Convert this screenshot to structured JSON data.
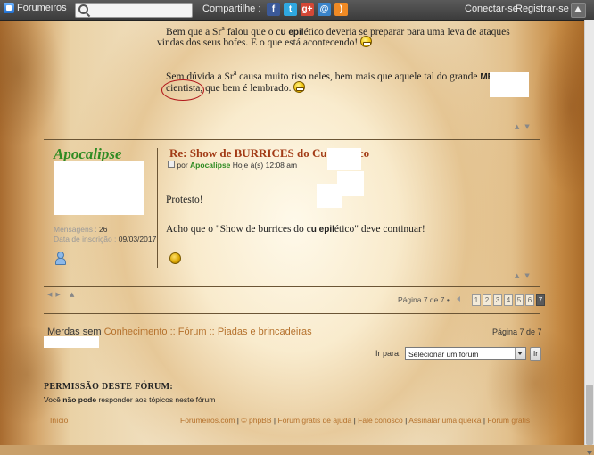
{
  "topbar": {
    "brand": "Forumeiros",
    "share_label": "Compartilhe :",
    "share_icons": [
      {
        "name": "facebook-icon",
        "glyph": "f",
        "color": "#3b5998"
      },
      {
        "name": "twitter-icon",
        "glyph": "t",
        "color": "#2fa8e0"
      },
      {
        "name": "google-plus-icon",
        "glyph": "g+",
        "color": "#d34836"
      },
      {
        "name": "email-icon",
        "glyph": "@",
        "color": "#3a84c9"
      },
      {
        "name": "rss-icon",
        "glyph": ")",
        "color": "#f08a24"
      }
    ],
    "login": "Conectar-se",
    "register": "Registrar-se"
  },
  "post1": {
    "line1a": "Bem que a Sr",
    "sup": "a",
    "line1b": " falou que o c",
    "u": "u",
    "line1c": " epil",
    "line1d": "ético deveria se preparar para uma leva de ataques",
    "line2": "vindas dos seus bofes. E o que está acontecendo!",
    "line3a": "Sem dúvida a Sr",
    "line3b": " causa muito ",
    "line3c": "riso neles, bem mais que aquele tal do grande",
    "mestre": "MESTREE",
    "line4a": "cientista",
    "line4b": ", que bem é lembrado."
  },
  "post2": {
    "author": "Apocalipse",
    "title_a": "Re: Show de BURRICES do C",
    "title_u": "u",
    "title_b": " epil",
    "title_c": "ético",
    "meta_prefix": "por",
    "meta_author": "Apocalipse",
    "meta_time": "Hoje à(s) 12:08 am",
    "stat_messages_label": "Mensagens :",
    "stat_messages_value": "26",
    "stat_joined_label": "Data de inscrição :",
    "stat_joined_value": "09/03/2017",
    "body1": "Protesto!",
    "body2a": "Acho que o \"Show de burrices do c",
    "body2b": "u",
    "body2c": " epil",
    "body2d": "ético\" deve continuar!"
  },
  "pagination": {
    "label": "Página 7 de 7 •",
    "pages": [
      "1",
      "2",
      "3",
      "4",
      "5",
      "6",
      "7"
    ],
    "active": "7"
  },
  "breadcrumb": {
    "root": "Merdas sem",
    "items": [
      "Conhecimento",
      "::",
      "Fórum",
      "::",
      "Piadas e brincadeiras"
    ]
  },
  "page_of": "Página 7 de 7",
  "jump": {
    "label": "Ir para:",
    "selected": "Selecionar um fórum",
    "go": "Ir"
  },
  "permissions": {
    "title": "PERMISSÃO DESTE FÓRUM:",
    "text_a": "Você",
    "text_b": "não pode",
    "text_c": "responder aos tópicos neste fórum"
  },
  "footer": {
    "home": "Início",
    "links": [
      "Forumeiros.com",
      "|",
      "© phpBB",
      "|",
      "Fórum grátis de ajuda",
      "|",
      "Fale conosco",
      "|",
      "Assinalar uma queixa",
      "|",
      "Fórum grátis"
    ]
  }
}
